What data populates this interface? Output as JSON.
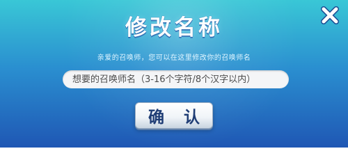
{
  "dialog": {
    "title": "修改名称",
    "subtitle": "亲爱的召唤师，您可以在这里修改你的召唤师名",
    "input": {
      "value": "",
      "placeholder": "想要的召唤师名（3-16个字符/8个汉字以内）"
    },
    "confirm_label": "确 认",
    "close_icon": "close-icon"
  },
  "colors": {
    "background_top": "#39c7d6",
    "background_bottom": "#1f57b4",
    "button_text": "#1f3d75"
  }
}
